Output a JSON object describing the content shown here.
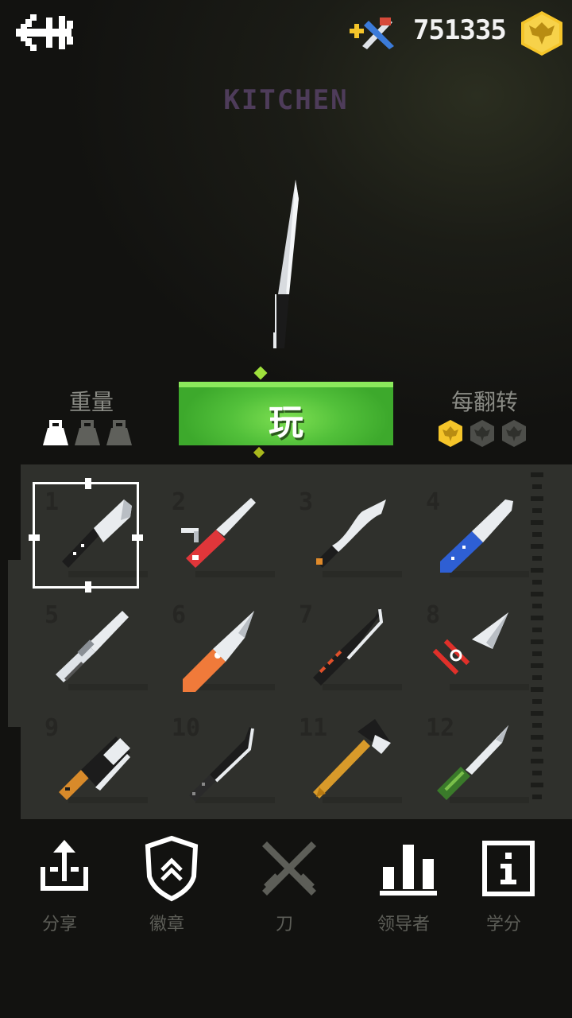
{
  "header": {
    "coins": "751335",
    "category": "KITCHEN"
  },
  "stats": {
    "weight_label": "重量",
    "weight_level": 1,
    "weight_max": 3,
    "flip_label": "每翻转",
    "flip_reward": 1,
    "flip_max": 3
  },
  "play_label": "玩",
  "knives": [
    {
      "num": "1",
      "icon": "chef-knife-icon",
      "selected": true
    },
    {
      "num": "2",
      "icon": "swiss-army-knife-icon"
    },
    {
      "num": "3",
      "icon": "kukri-knife-icon"
    },
    {
      "num": "4",
      "icon": "blue-handle-knife-icon"
    },
    {
      "num": "5",
      "icon": "butterfly-knife-icon"
    },
    {
      "num": "6",
      "icon": "orange-folding-knife-icon"
    },
    {
      "num": "7",
      "icon": "striped-handle-knife-icon"
    },
    {
      "num": "8",
      "icon": "red-kunai-icon"
    },
    {
      "num": "9",
      "icon": "cleaver-icon"
    },
    {
      "num": "10",
      "icon": "machete-icon"
    },
    {
      "num": "11",
      "icon": "hatchet-icon"
    },
    {
      "num": "12",
      "icon": "green-grip-knife-icon"
    }
  ],
  "nav": [
    {
      "label": "分享",
      "icon": "share-icon"
    },
    {
      "label": "徽章",
      "icon": "badge-icon"
    },
    {
      "label": "刀",
      "icon": "crossed-knives-icon"
    },
    {
      "label": "领导者",
      "icon": "leaderboard-icon"
    },
    {
      "label": "学分",
      "icon": "info-icon"
    }
  ],
  "colors": {
    "play_green": "#52c03a",
    "coin_gold": "#f5c52a",
    "title_purple": "#4e3c5a",
    "panel": "#2f302c"
  }
}
